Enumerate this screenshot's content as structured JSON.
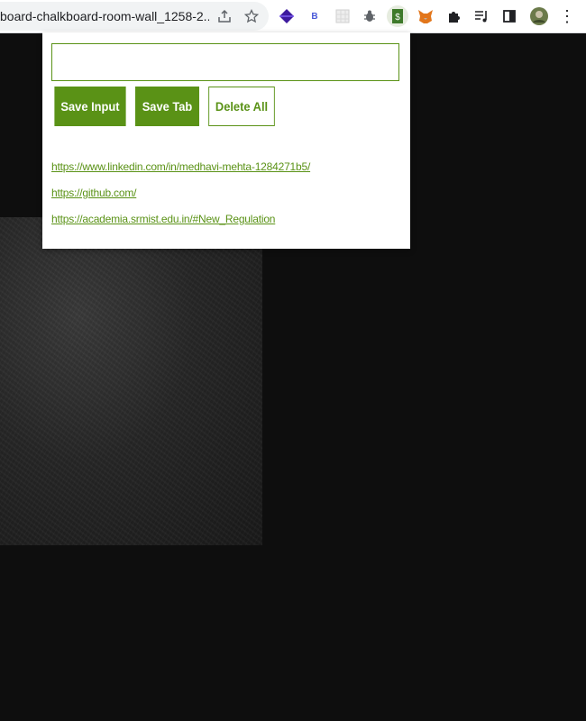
{
  "browser": {
    "url_text": "board-chalkboard-room-wall_1258-2...",
    "share_icon": "share-icon",
    "bookmark_icon": "star-icon",
    "extensions": [
      {
        "name": "purple-diamond-icon",
        "glyph": "◆",
        "color": "#3d1a9e"
      },
      {
        "name": "b-extension-icon",
        "glyph": "B",
        "color": "#4a5ad8"
      },
      {
        "name": "grid-extension-icon",
        "glyph": "▦",
        "color": "#bdbdbd"
      },
      {
        "name": "bug-icon",
        "glyph": "🐞",
        "color": "#5f6368"
      },
      {
        "name": "dollar-extension-icon",
        "glyph": "$",
        "color": "#3e7a2a"
      },
      {
        "name": "fox-icon",
        "glyph": "🦊",
        "color": "#e2761b"
      },
      {
        "name": "puzzle-icon",
        "glyph": "✱",
        "color": "#202124"
      },
      {
        "name": "media-queue-icon",
        "glyph": "☰",
        "color": "#202124"
      },
      {
        "name": "side-panel-icon",
        "glyph": "▯",
        "color": "#202124"
      },
      {
        "name": "avatar",
        "glyph": "",
        "color": "#6b7a4a"
      },
      {
        "name": "more-menu-icon",
        "glyph": "⋮",
        "color": "#202124"
      }
    ]
  },
  "popup": {
    "input": {
      "value": "",
      "placeholder": ""
    },
    "buttons": {
      "save_input": "Save Input",
      "save_tab": "Save Tab",
      "delete_all": "Delete All"
    },
    "leads": [
      "https://www.linkedin.com/in/medhavi-mehta-1284271b5/",
      "https://github.com/",
      "https://academia.srmist.edu.in/#New_Regulation"
    ]
  },
  "colors": {
    "accent": "#5a9216",
    "page_background": "#0e0e0e"
  }
}
